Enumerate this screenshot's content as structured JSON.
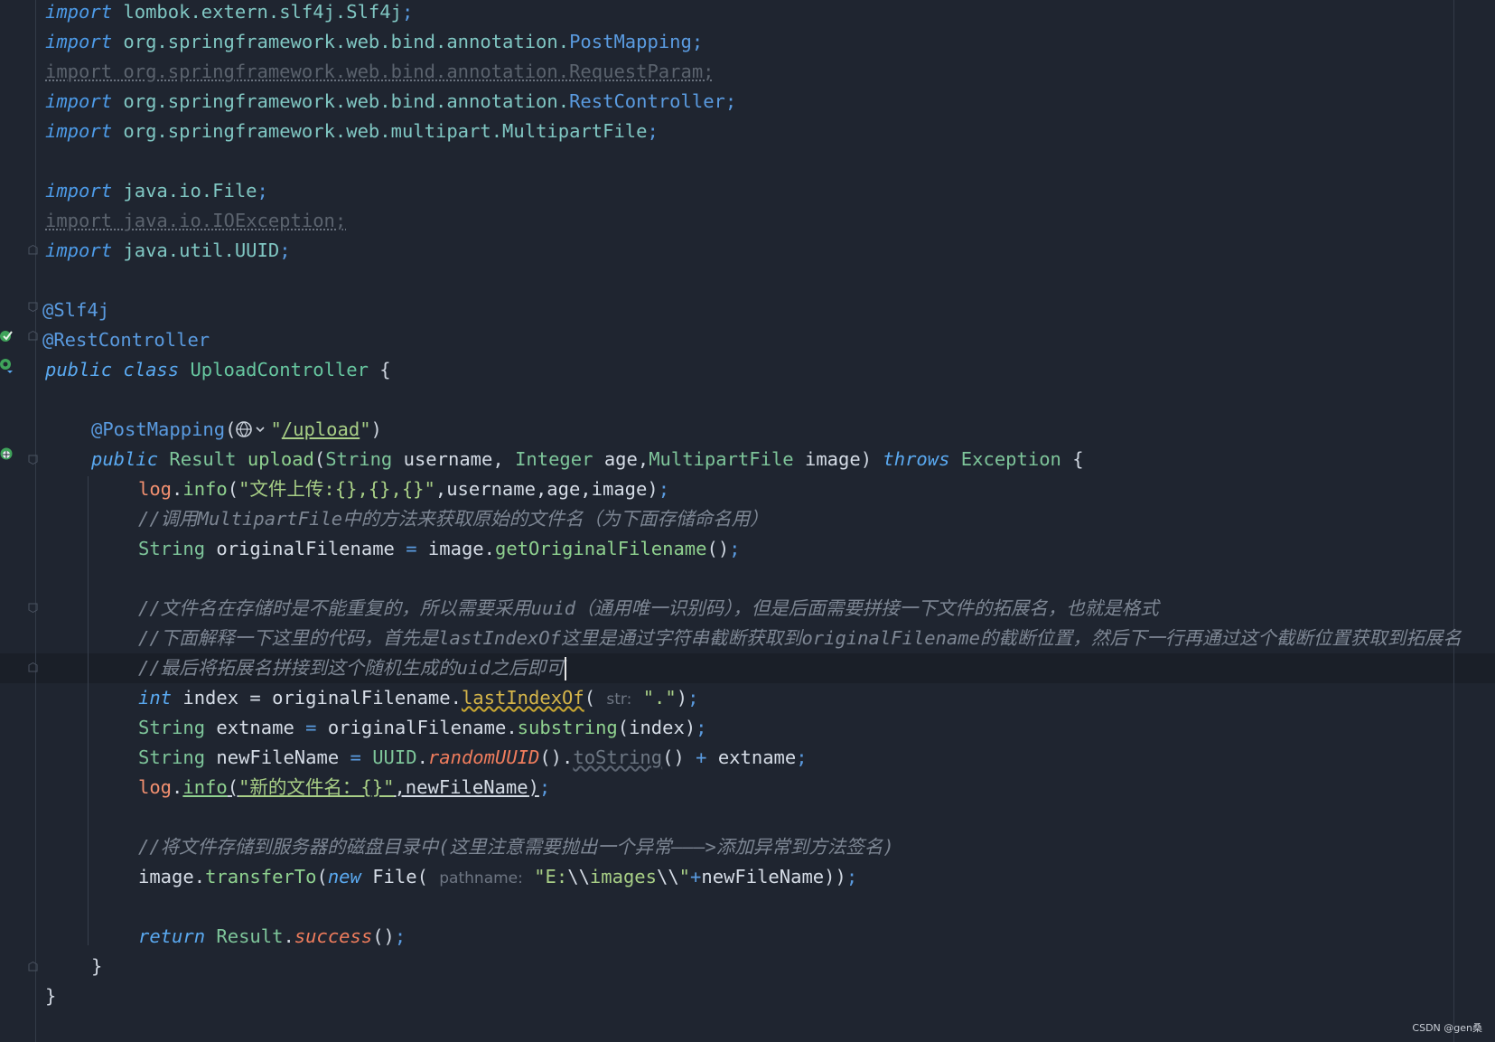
{
  "editor": {
    "language": "java",
    "watermark": "CSDN @gen桑",
    "code": {
      "l1": {
        "kw": "import",
        "pkg": "lombok.extern.slf4j.",
        "cls": "Slf4j",
        "semi": ";"
      },
      "l2": {
        "kw": "import",
        "pkg": "org.springframework.web.bind.annotation.",
        "cls": "PostMapping",
        "semi": ";"
      },
      "l3": {
        "text": "import org.springframework.web.bind.annotation.RequestParam;"
      },
      "l4": {
        "kw": "import",
        "pkg": "org.springframework.web.bind.annotation.",
        "cls": "RestController",
        "semi": ";"
      },
      "l5": {
        "kw": "import",
        "pkg": "org.springframework.web.multipart.",
        "cls": "MultipartFile",
        "semi": ";"
      },
      "l7": {
        "kw": "import",
        "pkg": "java.io.",
        "cls": "File",
        "semi": ";"
      },
      "l8": {
        "text": "import java.io.IOException;"
      },
      "l9": {
        "kw": "import",
        "pkg": "java.util.",
        "cls": "UUID",
        "semi": ";"
      },
      "l11": {
        "ann": "@Slf4j"
      },
      "l12": {
        "ann": "@RestController"
      },
      "l13": {
        "kw1": "public",
        "kw2": "class",
        "cls": "UploadController",
        "brace": " {"
      },
      "l15": {
        "ann": "@PostMapping",
        "open": "(",
        "q1": "\"",
        "path": "/upload",
        "q2": "\"",
        "close": ")"
      },
      "l16": {
        "public": "public",
        "ret": "Result",
        "name": "upload",
        "open": "(",
        "t1": "String",
        "p1": "username",
        "c1": ", ",
        "t2": "Integer",
        "p2": "age",
        "c2": ",",
        "t3": "MultipartFile",
        "p3": "image",
        "close": ")",
        "throws": "throws",
        "exc": "Exception",
        "brace": " {"
      },
      "l17": {
        "log": "log",
        "dot": ".",
        "m": "info",
        "open": "(",
        "str": "\"文件上传:{},{},{}\"",
        "args": ",username,age,image",
        "close": ")",
        "semi": ";"
      },
      "l18": {
        "cmt": "//调用MultipartFile中的方法来获取原始的文件名（为下面存储命名用）"
      },
      "l19": {
        "t": "String",
        "v": "originalFilename",
        "eq": " = ",
        "obj": "image",
        "dot": ".",
        "m": "getOriginalFilename",
        "paren": "()",
        "semi": ";"
      },
      "l21": {
        "cmt": "//文件名在存储时是不能重复的，所以需要采用uuid（通用唯一识别码），但是后面需要拼接一下文件的拓展名，也就是格式"
      },
      "l22": {
        "cmt": "//下面解释一下这里的代码，首先是lastIndexOf这里是通过字符串截断获取到originalFilename的截断位置，然后下一行再通过这个截断位置获取到拓展名"
      },
      "l23": {
        "cmt": "//最后将拓展名拼接到这个随机生成的uid之后即可"
      },
      "l24": {
        "kw": "int",
        "v": "index",
        "eq": " = ",
        "obj": "originalFilename",
        "dot": ".",
        "m": "lastIndexOf",
        "open": "(",
        "hint": "str:",
        "str": "\".\"",
        "close": ")",
        "semi": ";"
      },
      "l25": {
        "t": "String",
        "v": "extname",
        "eq": " = ",
        "obj": "originalFilename",
        "dot": ".",
        "m": "substring",
        "open": "(",
        "arg": "index",
        "close": ")",
        "semi": ";"
      },
      "l26": {
        "t": "String",
        "v": "newFileName",
        "eq": " = ",
        "cls": "UUID",
        "dot": ".",
        "m": "randomUUID",
        "paren": "()",
        "dot2": ".",
        "m2": "toString",
        "paren2": "()",
        "plus": " + ",
        "arg": "extname",
        "semi": ";"
      },
      "l27": {
        "log": "log",
        "dot": ".",
        "m": "info",
        "open": "(",
        "str": "\"新的文件名：{}\"",
        "args": ",newFileName",
        "close": ")",
        "semi": ";"
      },
      "l29": {
        "cmt": "//将文件存储到服务器的磁盘目录中(这里注意需要抛出一个异常———>添加异常到方法签名)"
      },
      "l30": {
        "obj": "image",
        "dot": ".",
        "m": "transferTo",
        "open": "(",
        "kw": "new",
        "cls": " File",
        "open2": "(",
        "hint": "pathname:",
        "s1": "\"E:",
        "esc1": "\\\\",
        "s2": "images",
        "esc2": "\\\\",
        "s3": "\"",
        "plus": "+",
        "arg": "newFileName",
        "close": "))",
        "semi": ";"
      },
      "l32": {
        "kw": "return",
        "cls": "Result",
        "dot": ".",
        "m": "success",
        "paren": "()",
        "semi": ";"
      },
      "l33": {
        "brace": "}"
      },
      "l34": {
        "brace": "}"
      }
    }
  }
}
